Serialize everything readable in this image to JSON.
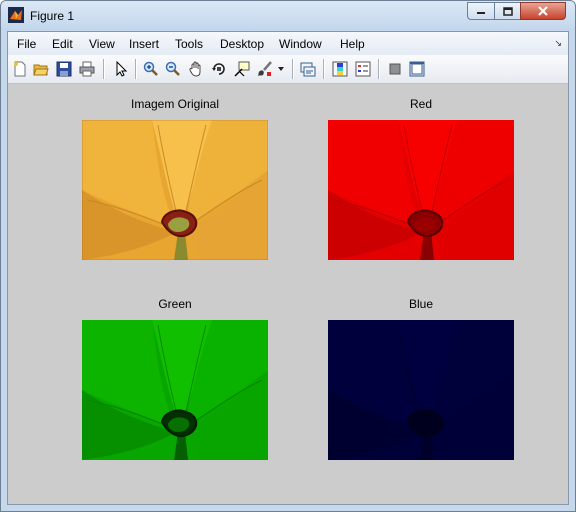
{
  "window": {
    "title": "Figure 1"
  },
  "menu": {
    "items": [
      "File",
      "Edit",
      "View",
      "Insert",
      "Tools",
      "Desktop",
      "Window",
      "Help"
    ]
  },
  "toolbar": {
    "buttons": [
      "new-figure-icon",
      "open-file-icon",
      "save-icon",
      "print-icon",
      "edit-plot-arrow-icon",
      "zoom-in-icon",
      "zoom-out-icon",
      "pan-hand-icon",
      "rotate-3d-icon",
      "data-cursor-icon",
      "brush-icon",
      "brush-dropdown-icon",
      "link-plot-icon",
      "insert-colorbar-icon",
      "insert-legend-icon",
      "hide-plot-tools-icon",
      "show-plot-tools-icon"
    ]
  },
  "axes": [
    {
      "title": "Imagem Original",
      "channel": "original"
    },
    {
      "title": "Red",
      "channel": "red"
    },
    {
      "title": "Green",
      "channel": "green"
    },
    {
      "title": "Blue",
      "channel": "blue"
    }
  ],
  "colors": {
    "figure_background": "#cccccc",
    "titlebar": "#c2d6ec",
    "close_button": "#c7432c"
  }
}
